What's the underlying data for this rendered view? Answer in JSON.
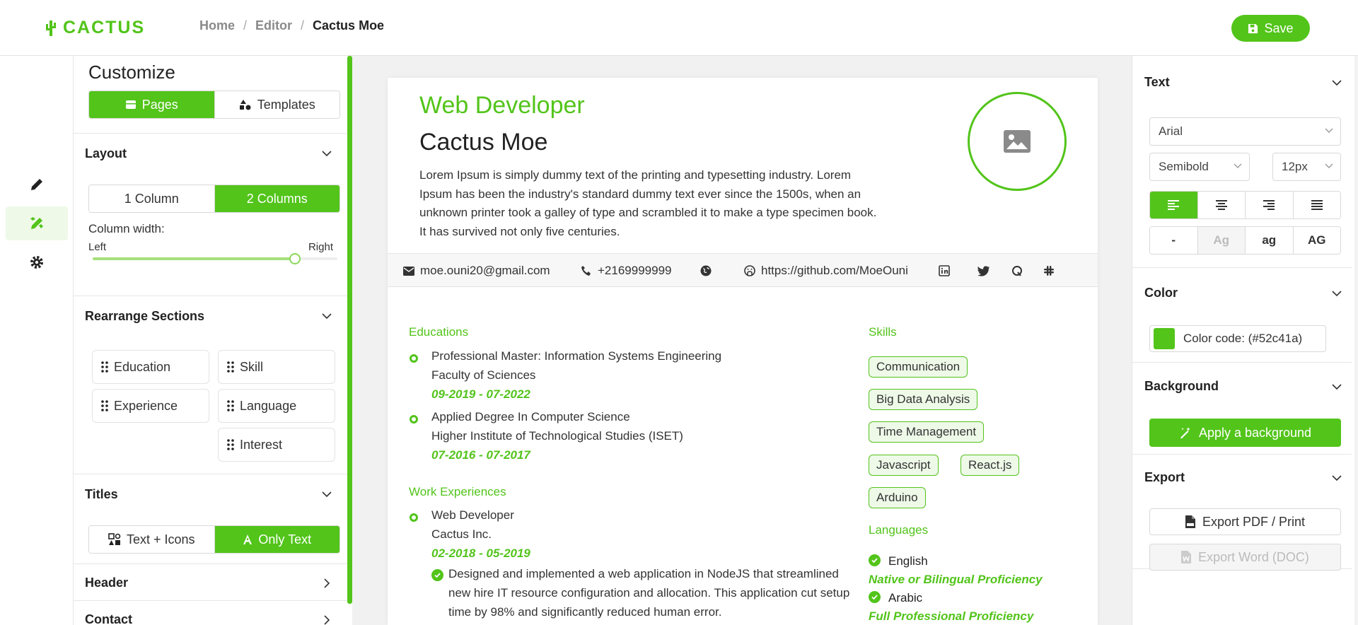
{
  "app": {
    "name": "CACTUS"
  },
  "breadcrumb": {
    "home": "Home",
    "editor": "Editor",
    "current": "Cactus Moe"
  },
  "toolbar": {
    "save_label": "Save"
  },
  "customize": {
    "title": "Customize",
    "tabs": [
      {
        "label": "Pages",
        "active": true
      },
      {
        "label": "Templates",
        "active": false
      }
    ],
    "layout": {
      "title": "Layout",
      "options": [
        {
          "label": "1 Column",
          "active": false
        },
        {
          "label": "2 Columns",
          "active": true
        }
      ],
      "column_width_label": "Column width:",
      "left_label": "Left",
      "right_label": "Right",
      "slider_value": 0.8
    },
    "rearrange": {
      "title": "Rearrange Sections",
      "items": [
        "Education",
        "Skill",
        "Experience",
        "Language",
        "Interest"
      ]
    },
    "titles": {
      "title": "Titles",
      "options": [
        {
          "label": "Text + Icons",
          "active": false
        },
        {
          "label": "Only Text",
          "active": true
        }
      ]
    },
    "header_section": {
      "title": "Header"
    },
    "contact_section": {
      "title": "Contact"
    }
  },
  "resume": {
    "title": "Web Developer",
    "name": "Cactus Moe",
    "about": "Lorem Ipsum is simply dummy text of the printing and typesetting industry. Lorem Ipsum has been the industry's standard dummy text ever since the 1500s, when an unknown printer took a galley of type and scrambled it to make a type specimen book. It has survived not only five centuries.",
    "contact": {
      "email": "moe.ouni20@gmail.com",
      "phone": "+2169999999",
      "github": "https://github.com/MoeOuni"
    },
    "educations_title": "Educations",
    "educations": [
      {
        "degree": "Professional Master: Information Systems Engineering",
        "school": "Faculty of Sciences",
        "dates": "09-2019 - 07-2022"
      },
      {
        "degree": "Applied Degree In Computer Science",
        "school": "Higher Institute of Technological Studies (ISET)",
        "dates": "07-2016 - 07-2017"
      }
    ],
    "work_title": "Work Experiences",
    "work": [
      {
        "role": "Web Developer",
        "company": "Cactus Inc.",
        "dates": "02-2018 - 05-2019",
        "bullet": "Designed and implemented a web application in NodeJS that streamlined new hire IT resource configuration and allocation. This application cut setup time by 98% and significantly reduced human error."
      }
    ],
    "skills_title": "Skills",
    "skills": [
      "Communication",
      "Big Data Analysis",
      "Time Management",
      "Javascript",
      "React.js",
      "Arduino"
    ],
    "languages_title": "Languages",
    "languages": [
      {
        "name": "English",
        "level": "Native or Bilingual Proficiency"
      },
      {
        "name": "Arabic",
        "level": "Full Professional Proficiency"
      }
    ]
  },
  "props": {
    "text": {
      "title": "Text",
      "font": "Arial",
      "weight": "Semibold",
      "size": "12px",
      "alignments": [
        "left",
        "center",
        "right",
        "justify"
      ],
      "alignment_active": "left",
      "case_options": [
        "-",
        "Ag",
        "ag",
        "AG"
      ]
    },
    "color": {
      "title": "Color",
      "label": "Color code: (#52c41a)",
      "value": "#52c41a"
    },
    "background": {
      "title": "Background",
      "apply_label": "Apply a background"
    },
    "export": {
      "title": "Export",
      "pdf_label": "Export PDF / Print",
      "word_label": "Export Word (DOC)"
    }
  },
  "colors": {
    "accent": "#52c41a"
  }
}
